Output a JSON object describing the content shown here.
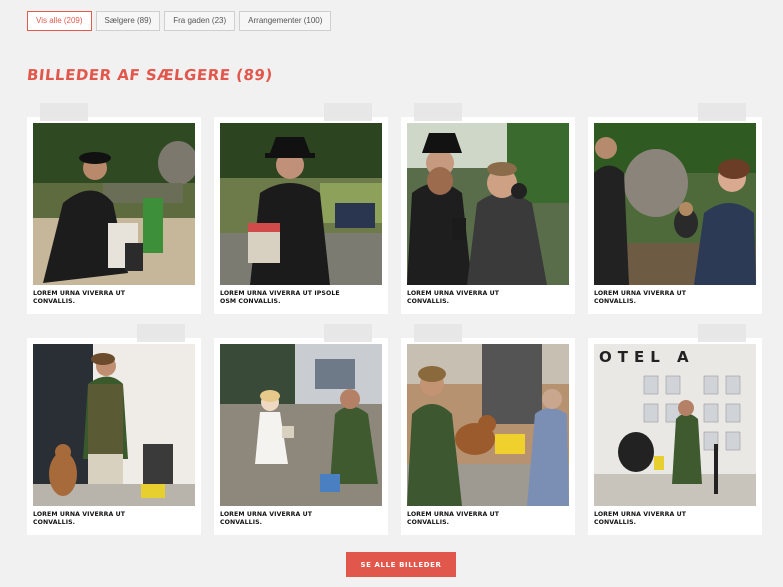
{
  "filters": [
    {
      "label": "Vis alle (209)",
      "active": true
    },
    {
      "label": "Sælgere (89)",
      "active": false
    },
    {
      "label": "Fra gaden (23)",
      "active": false
    },
    {
      "label": "Arrangementer (100)",
      "active": false
    }
  ],
  "heading": "Billeder af sælgere (89)",
  "cards": [
    {
      "caption": "Lorem urna viverra ut convallis."
    },
    {
      "caption": "Lorem urna viverra ut ipsole osm convallis."
    },
    {
      "caption": "Lorem urna viverra ut convallis."
    },
    {
      "caption": "Lorem urna viverra ut convallis."
    },
    {
      "caption": "Lorem urna viverra ut convallis."
    },
    {
      "caption": "Lorem urna viverra ut convallis."
    },
    {
      "caption": "Lorem urna viverra ut convallis."
    },
    {
      "caption": "Lorem urna viverra ut convallis."
    }
  ],
  "photo_sign_text": "OTEL A",
  "see_all_label": "Se alle billeder",
  "colors": {
    "accent": "#e2574c",
    "background": "#f1f1f1"
  }
}
